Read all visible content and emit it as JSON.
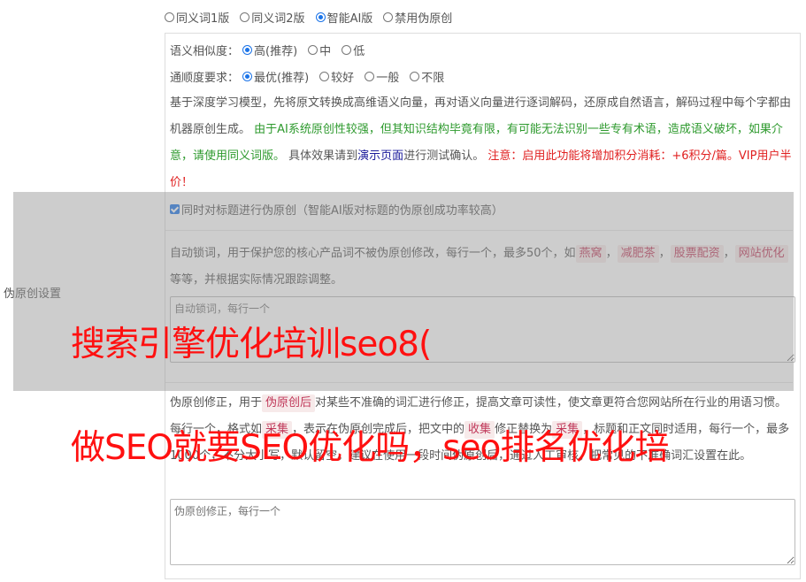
{
  "mode_options": [
    "同义词1版",
    "同义词2版",
    "智能AI版",
    "禁用伪原创"
  ],
  "mode_selected": "智能AI版",
  "similarity": {
    "label": "语义相似度：",
    "options": [
      "高(推荐)",
      "中",
      "低"
    ],
    "selected": "高(推荐)"
  },
  "fluency": {
    "label": "通顺度要求：",
    "options": [
      "最优(推荐)",
      "较好",
      "一般",
      "不限"
    ],
    "selected": "最优(推荐)"
  },
  "description": {
    "part1": "基于深度学习模型，先将原文转换成高维语义向量，再对语义向量进行逐词解码，还原成自然语言，解码过程中每个字都由机器原创生成。",
    "part2_green": "由于AI系统原创性较强，但其知识结构毕竟有限，有可能无法识别一些专有术语，造成语义破坏，如果介意，请使用同义词版。",
    "part3": "具体效果请到",
    "link": "演示页面",
    "part4": "进行测试确认。",
    "warning": "注意：启用此功能将增加积分消耗：+6积分/篇。VIP用户半价！"
  },
  "title_checkbox": {
    "checked": true,
    "label": "同时对标题进行伪原创（智能AI版对标题的伪原创成功率较高）"
  },
  "lock_words": {
    "text1": "自动锁词，用于保护您的核心产品词不被伪原创修改，每行一个，最多50个，如",
    "tags": [
      "燕窝",
      "减肥茶",
      "股票配资",
      "网站优化"
    ],
    "sep": "，",
    "text2": "等等，并根据实际情况跟踪调整。",
    "placeholder": "自动锁词，每行一个"
  },
  "correction": {
    "text1": "伪原创修正，用于",
    "tag1": "伪原创后",
    "text2": "对某些不准确的词汇进行修正，提高文章可读性，使文章更符合您网站所在行业的用语习惯。每行一个，格式如",
    "tag2": "采集",
    "text3": "，表示在伪原创完成后，把文中的",
    "tag3": "收集",
    "text4": "修正替换为",
    "tag4": "采集",
    "text5": "，标题和正文同时适用，每行一个，最多1000个，不分大小写，默认留空。建议在使用一段时间伪原创后，通过人工审核，把常见的不准确词汇设置在此。",
    "placeholder": "伪原创修正，每行一个"
  },
  "left_label": "伪原创设置",
  "watermark": {
    "line1": "搜索引擎优化培训seo8(",
    "line2": "做SEO就要SEO优化吗，seo排名优化培"
  },
  "colors": {
    "accent": "#1a73e8",
    "green": "#2e9a2e",
    "red": "#e02020",
    "tag_bg": "#f7eaea",
    "tag_fg": "#c0395a",
    "watermark": "#ff1010"
  }
}
